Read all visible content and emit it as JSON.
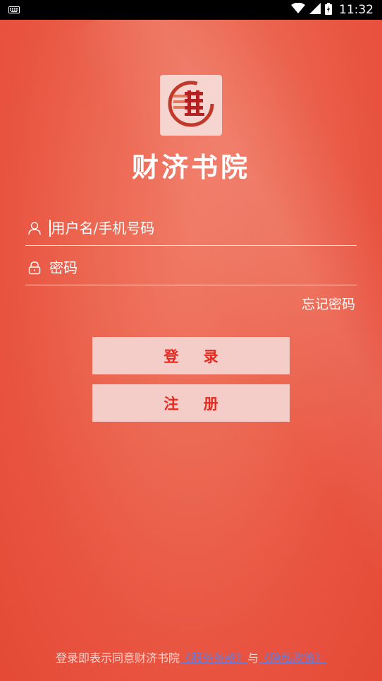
{
  "status_bar": {
    "time": "11:32",
    "icons": [
      "keyboard-icon",
      "wifi-icon",
      "signal-icon",
      "battery-icon"
    ]
  },
  "app": {
    "name": "财济书院",
    "logo_icon": "book-logo-icon"
  },
  "login_form": {
    "username_placeholder": "用户名/手机号码",
    "password_placeholder": "密码",
    "forgot_password": "忘记密码",
    "login_button": "登 录",
    "register_button": "注 册"
  },
  "agreement": {
    "prefix": "登录即表示同意财济书院",
    "terms_link": "《服务条款》",
    "joiner": "与",
    "privacy_link": "《隐私政策》"
  },
  "colors": {
    "background": "#e9533f",
    "button_bg": "#f5cdc8",
    "button_text": "#e8291f",
    "link": "#6b7bd6"
  }
}
